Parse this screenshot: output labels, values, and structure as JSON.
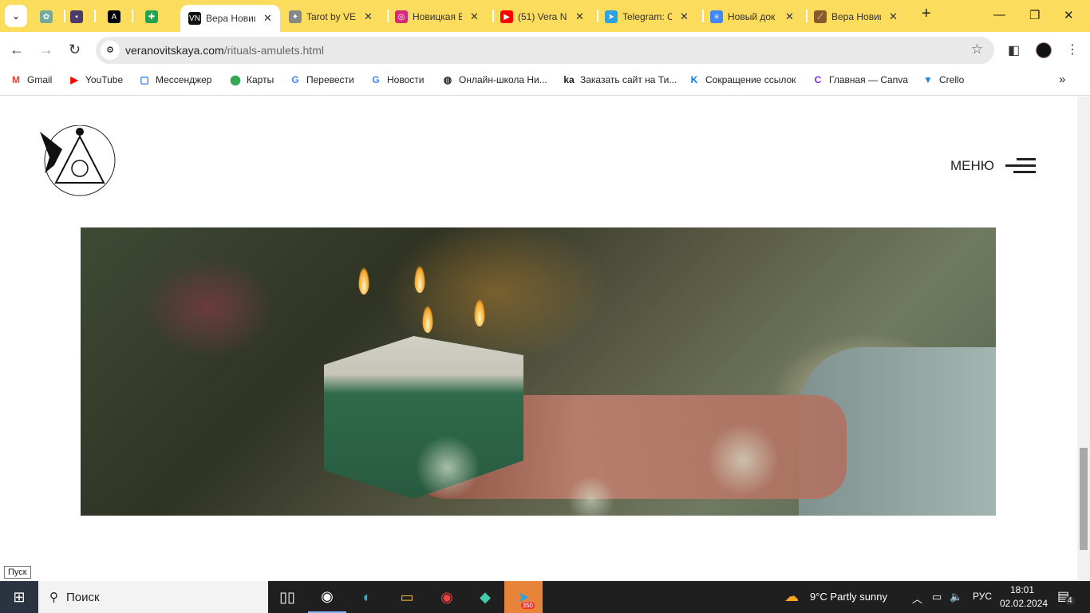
{
  "tabs": [
    {
      "title": "",
      "icon": "chatgpt-icon",
      "color": "#74aa9c"
    },
    {
      "title": "",
      "icon": "site-icon",
      "color": "#4a3b6b"
    },
    {
      "title": "",
      "icon": "letter-a-icon",
      "color": "#000000"
    },
    {
      "title": "",
      "icon": "green-cross-icon",
      "color": "#22a350"
    },
    {
      "title": "Вера Новицкая",
      "icon": "vn-icon",
      "color": "#111111",
      "active": true
    },
    {
      "title": "Tarot by VERA",
      "icon": "tarot-icon",
      "color": "#888888"
    },
    {
      "title": "Новицкая Вера",
      "icon": "instagram-icon",
      "color": "#d62976"
    },
    {
      "title": "(51) Vera N",
      "icon": "youtube-icon",
      "color": "#ff0000"
    },
    {
      "title": "Telegram: C",
      "icon": "telegram-icon",
      "color": "#2aa3e0"
    },
    {
      "title": "Новый док",
      "icon": "google-docs-icon",
      "color": "#4285f4"
    },
    {
      "title": "Вера Новицкая",
      "icon": "telescope-icon",
      "color": "#8b5a2b"
    }
  ],
  "toolbar": {
    "url_host": "veranovitskaya.com",
    "url_path": "/rituals-amulets.html"
  },
  "bookmarks": [
    {
      "label": "Gmail",
      "icon": "gmail-icon"
    },
    {
      "label": "YouTube",
      "icon": "youtube-icon"
    },
    {
      "label": "Мессенджер",
      "icon": "messenger-icon"
    },
    {
      "label": "Карты",
      "icon": "maps-icon"
    },
    {
      "label": "Перевести",
      "icon": "translate-icon"
    },
    {
      "label": "Новости",
      "icon": "news-icon"
    },
    {
      "label": "Онлайн-школа Ни...",
      "icon": "globe-icon"
    },
    {
      "label": "Заказать сайт на Ти...",
      "icon": "tilda-icon"
    },
    {
      "label": "Сокращение ссылок",
      "icon": "vk-icon"
    },
    {
      "label": "Главная — Canva",
      "icon": "canva-icon"
    },
    {
      "label": "Crello",
      "icon": "crello-icon"
    }
  ],
  "page": {
    "menu_label": "МЕНЮ"
  },
  "tooltip": "Пуск",
  "taskbar": {
    "search_label": "Поиск",
    "telegram_badge": "350",
    "weather": "9°C  Partly sunny",
    "lang": "РУС",
    "time": "18:01",
    "date": "02.02.2024",
    "notifications": "4"
  }
}
